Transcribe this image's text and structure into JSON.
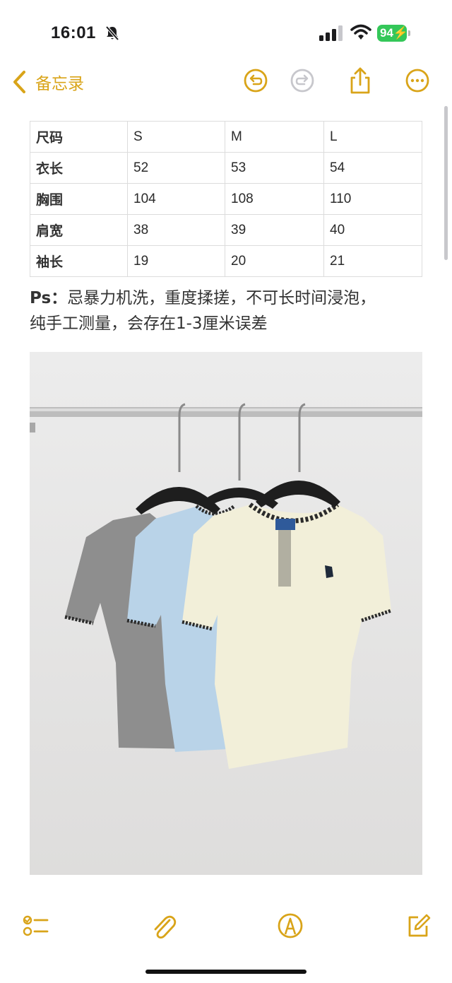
{
  "status_bar": {
    "time": "16:01",
    "battery": "94",
    "icons": [
      "bell-slash-icon",
      "cellular-signal-icon",
      "wifi-icon",
      "battery-icon"
    ]
  },
  "nav": {
    "back_label": "备忘录",
    "icons": [
      "back-chevron-icon",
      "undo-icon",
      "redo-icon",
      "share-icon",
      "more-icon"
    ]
  },
  "table": {
    "rows": [
      [
        "尺码",
        "S",
        "M",
        "L"
      ],
      [
        "衣长",
        "52",
        "53",
        "54"
      ],
      [
        "胸围",
        "104",
        "108",
        "110"
      ],
      [
        "肩宽",
        "38",
        "39",
        "40"
      ],
      [
        "袖长",
        "19",
        "20",
        "21"
      ]
    ]
  },
  "note": {
    "prefix": "Ps：",
    "line1": "忌暴力机洗，重度揉搓，不可长时间浸泡，",
    "line2": "纯手工测量，会存在1-3厘米误差"
  },
  "toolbar": {
    "icons": [
      "checklist-icon",
      "paperclip-icon",
      "markup-pen-icon",
      "compose-icon"
    ]
  },
  "colors": {
    "accent": "#d9a419",
    "battery": "#34c759",
    "shirt_grey": "#8e8e8e",
    "shirt_blue": "#b9d3e8",
    "shirt_cream": "#f2efd9"
  }
}
